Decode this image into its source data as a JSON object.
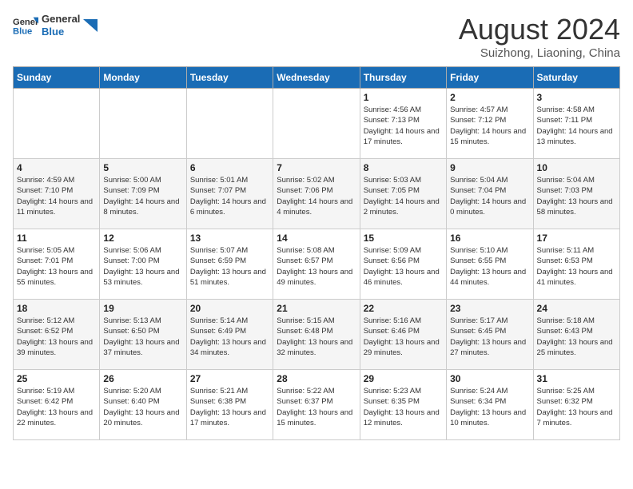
{
  "header": {
    "logo_text_general": "General",
    "logo_text_blue": "Blue",
    "month": "August 2024",
    "location": "Suizhong, Liaoning, China"
  },
  "weekdays": [
    "Sunday",
    "Monday",
    "Tuesday",
    "Wednesday",
    "Thursday",
    "Friday",
    "Saturday"
  ],
  "weeks": [
    [
      {
        "day": "",
        "sunrise": "",
        "sunset": "",
        "daylight": ""
      },
      {
        "day": "",
        "sunrise": "",
        "sunset": "",
        "daylight": ""
      },
      {
        "day": "",
        "sunrise": "",
        "sunset": "",
        "daylight": ""
      },
      {
        "day": "",
        "sunrise": "",
        "sunset": "",
        "daylight": ""
      },
      {
        "day": "1",
        "sunrise": "Sunrise: 4:56 AM",
        "sunset": "Sunset: 7:13 PM",
        "daylight": "Daylight: 14 hours and 17 minutes."
      },
      {
        "day": "2",
        "sunrise": "Sunrise: 4:57 AM",
        "sunset": "Sunset: 7:12 PM",
        "daylight": "Daylight: 14 hours and 15 minutes."
      },
      {
        "day": "3",
        "sunrise": "Sunrise: 4:58 AM",
        "sunset": "Sunset: 7:11 PM",
        "daylight": "Daylight: 14 hours and 13 minutes."
      }
    ],
    [
      {
        "day": "4",
        "sunrise": "Sunrise: 4:59 AM",
        "sunset": "Sunset: 7:10 PM",
        "daylight": "Daylight: 14 hours and 11 minutes."
      },
      {
        "day": "5",
        "sunrise": "Sunrise: 5:00 AM",
        "sunset": "Sunset: 7:09 PM",
        "daylight": "Daylight: 14 hours and 8 minutes."
      },
      {
        "day": "6",
        "sunrise": "Sunrise: 5:01 AM",
        "sunset": "Sunset: 7:07 PM",
        "daylight": "Daylight: 14 hours and 6 minutes."
      },
      {
        "day": "7",
        "sunrise": "Sunrise: 5:02 AM",
        "sunset": "Sunset: 7:06 PM",
        "daylight": "Daylight: 14 hours and 4 minutes."
      },
      {
        "day": "8",
        "sunrise": "Sunrise: 5:03 AM",
        "sunset": "Sunset: 7:05 PM",
        "daylight": "Daylight: 14 hours and 2 minutes."
      },
      {
        "day": "9",
        "sunrise": "Sunrise: 5:04 AM",
        "sunset": "Sunset: 7:04 PM",
        "daylight": "Daylight: 14 hours and 0 minutes."
      },
      {
        "day": "10",
        "sunrise": "Sunrise: 5:04 AM",
        "sunset": "Sunset: 7:03 PM",
        "daylight": "Daylight: 13 hours and 58 minutes."
      }
    ],
    [
      {
        "day": "11",
        "sunrise": "Sunrise: 5:05 AM",
        "sunset": "Sunset: 7:01 PM",
        "daylight": "Daylight: 13 hours and 55 minutes."
      },
      {
        "day": "12",
        "sunrise": "Sunrise: 5:06 AM",
        "sunset": "Sunset: 7:00 PM",
        "daylight": "Daylight: 13 hours and 53 minutes."
      },
      {
        "day": "13",
        "sunrise": "Sunrise: 5:07 AM",
        "sunset": "Sunset: 6:59 PM",
        "daylight": "Daylight: 13 hours and 51 minutes."
      },
      {
        "day": "14",
        "sunrise": "Sunrise: 5:08 AM",
        "sunset": "Sunset: 6:57 PM",
        "daylight": "Daylight: 13 hours and 49 minutes."
      },
      {
        "day": "15",
        "sunrise": "Sunrise: 5:09 AM",
        "sunset": "Sunset: 6:56 PM",
        "daylight": "Daylight: 13 hours and 46 minutes."
      },
      {
        "day": "16",
        "sunrise": "Sunrise: 5:10 AM",
        "sunset": "Sunset: 6:55 PM",
        "daylight": "Daylight: 13 hours and 44 minutes."
      },
      {
        "day": "17",
        "sunrise": "Sunrise: 5:11 AM",
        "sunset": "Sunset: 6:53 PM",
        "daylight": "Daylight: 13 hours and 41 minutes."
      }
    ],
    [
      {
        "day": "18",
        "sunrise": "Sunrise: 5:12 AM",
        "sunset": "Sunset: 6:52 PM",
        "daylight": "Daylight: 13 hours and 39 minutes."
      },
      {
        "day": "19",
        "sunrise": "Sunrise: 5:13 AM",
        "sunset": "Sunset: 6:50 PM",
        "daylight": "Daylight: 13 hours and 37 minutes."
      },
      {
        "day": "20",
        "sunrise": "Sunrise: 5:14 AM",
        "sunset": "Sunset: 6:49 PM",
        "daylight": "Daylight: 13 hours and 34 minutes."
      },
      {
        "day": "21",
        "sunrise": "Sunrise: 5:15 AM",
        "sunset": "Sunset: 6:48 PM",
        "daylight": "Daylight: 13 hours and 32 minutes."
      },
      {
        "day": "22",
        "sunrise": "Sunrise: 5:16 AM",
        "sunset": "Sunset: 6:46 PM",
        "daylight": "Daylight: 13 hours and 29 minutes."
      },
      {
        "day": "23",
        "sunrise": "Sunrise: 5:17 AM",
        "sunset": "Sunset: 6:45 PM",
        "daylight": "Daylight: 13 hours and 27 minutes."
      },
      {
        "day": "24",
        "sunrise": "Sunrise: 5:18 AM",
        "sunset": "Sunset: 6:43 PM",
        "daylight": "Daylight: 13 hours and 25 minutes."
      }
    ],
    [
      {
        "day": "25",
        "sunrise": "Sunrise: 5:19 AM",
        "sunset": "Sunset: 6:42 PM",
        "daylight": "Daylight: 13 hours and 22 minutes."
      },
      {
        "day": "26",
        "sunrise": "Sunrise: 5:20 AM",
        "sunset": "Sunset: 6:40 PM",
        "daylight": "Daylight: 13 hours and 20 minutes."
      },
      {
        "day": "27",
        "sunrise": "Sunrise: 5:21 AM",
        "sunset": "Sunset: 6:38 PM",
        "daylight": "Daylight: 13 hours and 17 minutes."
      },
      {
        "day": "28",
        "sunrise": "Sunrise: 5:22 AM",
        "sunset": "Sunset: 6:37 PM",
        "daylight": "Daylight: 13 hours and 15 minutes."
      },
      {
        "day": "29",
        "sunrise": "Sunrise: 5:23 AM",
        "sunset": "Sunset: 6:35 PM",
        "daylight": "Daylight: 13 hours and 12 minutes."
      },
      {
        "day": "30",
        "sunrise": "Sunrise: 5:24 AM",
        "sunset": "Sunset: 6:34 PM",
        "daylight": "Daylight: 13 hours and 10 minutes."
      },
      {
        "day": "31",
        "sunrise": "Sunrise: 5:25 AM",
        "sunset": "Sunset: 6:32 PM",
        "daylight": "Daylight: 13 hours and 7 minutes."
      }
    ]
  ]
}
